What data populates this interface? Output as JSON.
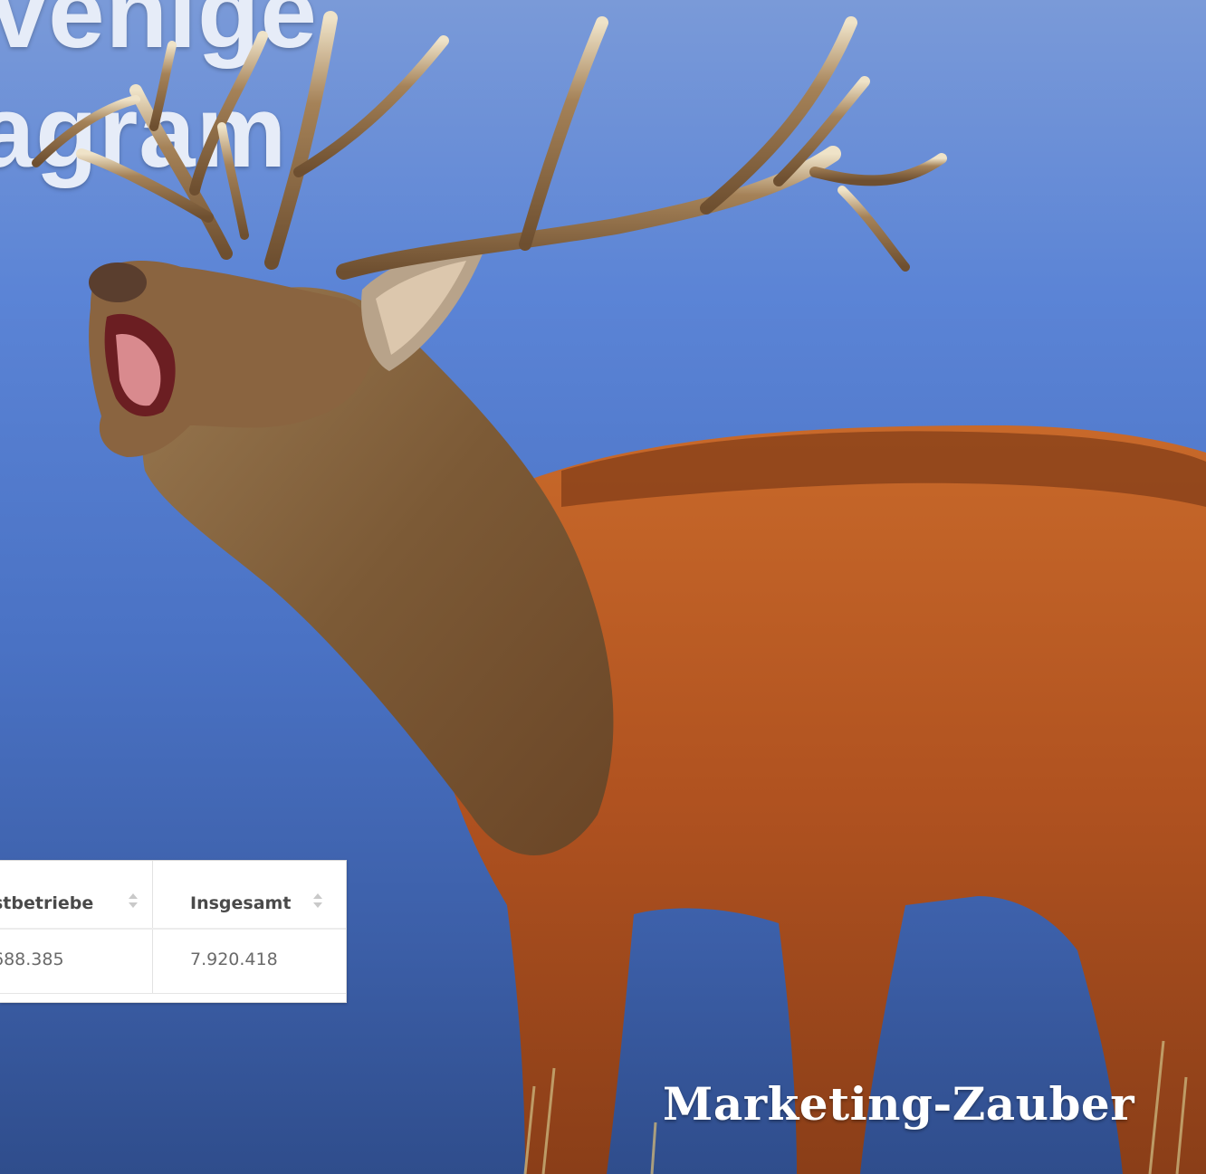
{
  "headline": {
    "line1": "venige",
    "line2": "agram"
  },
  "table": {
    "headers": [
      "stbetriebe",
      "Insgesamt"
    ],
    "rows": [
      [
        "688.385",
        "7.920.418"
      ]
    ]
  },
  "brand": "Marketing-Zauber",
  "colors": {
    "background_top": "#7a9ad8",
    "background_bottom": "#2f4d8c",
    "headline_text": "#e6ecf8",
    "deer_body": "#b75a22",
    "antler": "#8a6a45"
  },
  "icons": [
    "sort-icon",
    "stag-photo"
  ]
}
